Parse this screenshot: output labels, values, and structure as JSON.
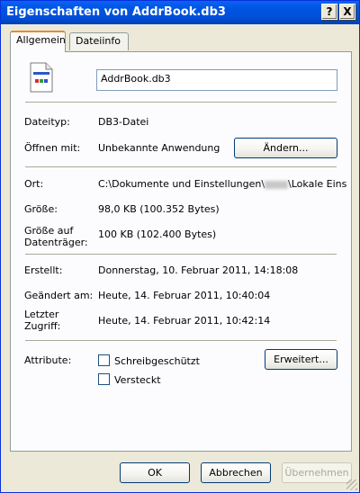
{
  "window": {
    "title": "Eigenschaften von AddrBook.db3"
  },
  "titlebar": {
    "help": "?",
    "close": "X"
  },
  "tabs": [
    {
      "label": "Allgemein",
      "active": true
    },
    {
      "label": "Dateiinfo",
      "active": false
    }
  ],
  "general": {
    "filename": "AddrBook.db3",
    "file_icon": "document-icon",
    "rows": {
      "type": {
        "label": "Dateityp:",
        "value": "DB3-Datei"
      },
      "opens_with": {
        "label": "Öffnen mit:",
        "value": "Unbekannte Anwendung",
        "button": "Ändern..."
      },
      "location": {
        "label": "Ort:",
        "value_start": "C:\\Dokumente und Einstellungen\\",
        "value_end": "\\Lokale Eins"
      },
      "size": {
        "label": "Größe:",
        "value": "98,0 KB (100.352 Bytes)"
      },
      "size_on_disk": {
        "label_line1": "Größe auf",
        "label_line2": "Datenträger:",
        "value": "100 KB (102.400 Bytes)"
      },
      "created": {
        "label": "Erstellt:",
        "value": "Donnerstag, 10. Februar 2011, 14:18:08"
      },
      "modified": {
        "label": "Geändert am:",
        "value": "Heute, 14. Februar 2011, 10:40:04"
      },
      "accessed": {
        "label_line1": "Letzter",
        "label_line2": "Zugriff:",
        "value": "Heute, 14. Februar 2011, 10:42:14"
      }
    },
    "attributes": {
      "label": "Attribute:",
      "readonly": {
        "label": "Schreibgeschützt",
        "checked": false
      },
      "hidden": {
        "label": "Versteckt",
        "checked": false
      },
      "advanced_button": "Erweitert..."
    }
  },
  "footer": {
    "ok": "OK",
    "cancel": "Abbrechen",
    "apply": "Übernehmen",
    "apply_enabled": false
  }
}
